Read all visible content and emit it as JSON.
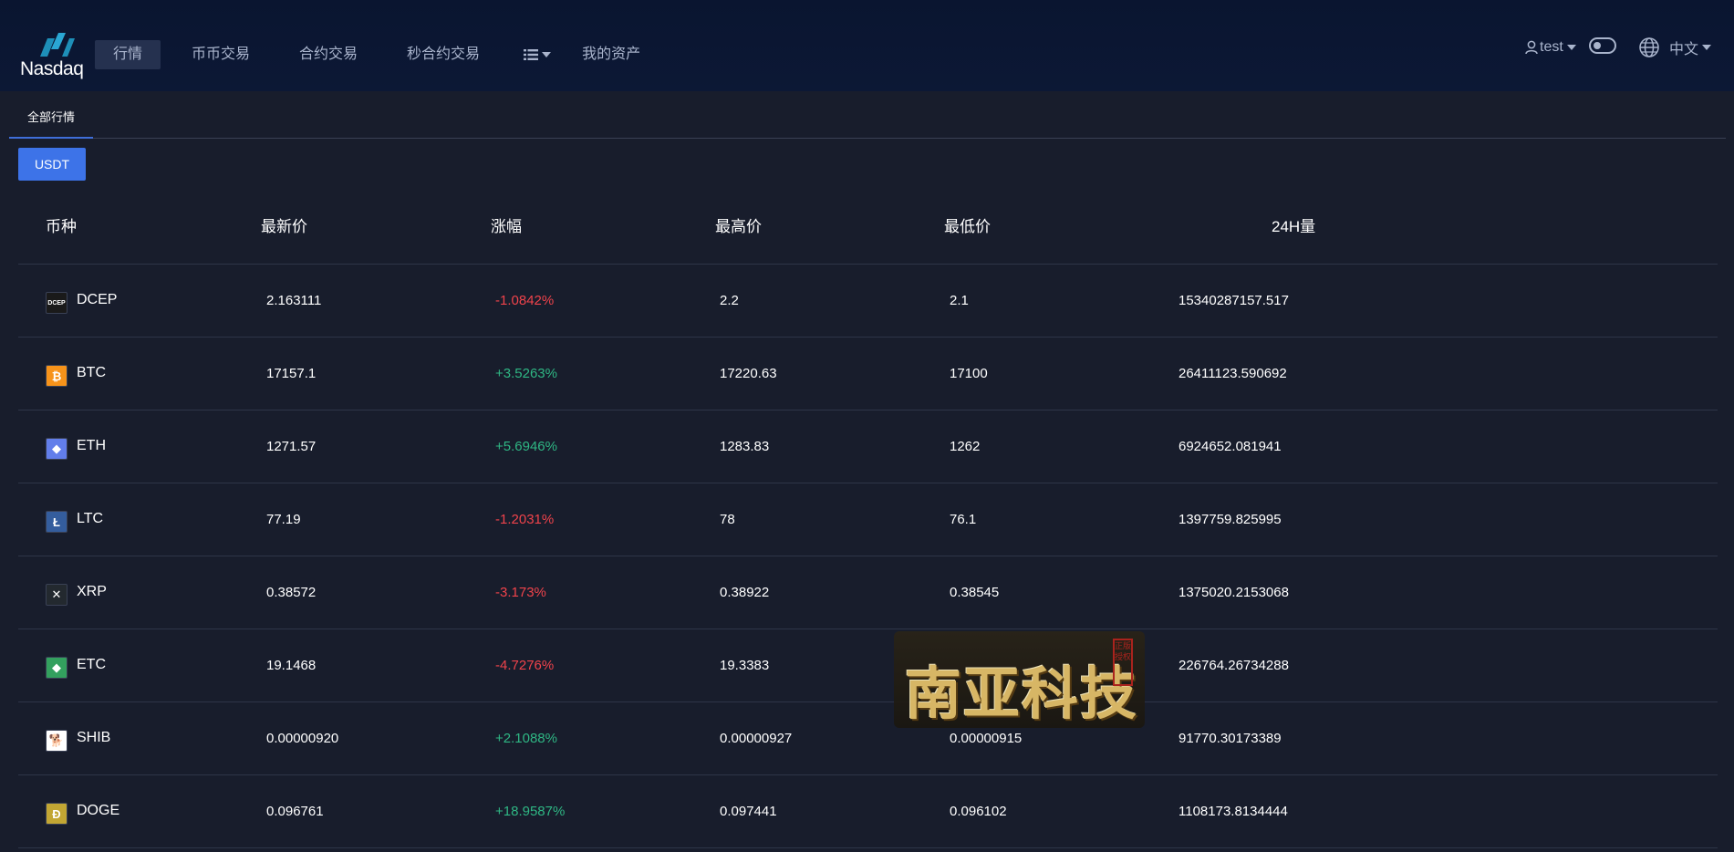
{
  "header": {
    "logo_text": "Nasdaq",
    "nav": [
      {
        "label": "行情",
        "active": true
      },
      {
        "label": "币币交易"
      },
      {
        "label": "合约交易"
      },
      {
        "label": "秒合约交易"
      }
    ],
    "assets_label": "我的资产",
    "user_label": "test",
    "lang_label": "中文"
  },
  "tabs": [
    {
      "label": "全部行情",
      "active": true
    }
  ],
  "quote_button": "USDT",
  "table": {
    "columns": [
      "币种",
      "最新价",
      "涨幅",
      "最高价",
      "最低价",
      "24H量"
    ],
    "rows": [
      {
        "coin": "DCEP",
        "icon": "dcep-icon",
        "icon_color": "#1a1a1a",
        "last": "2.163111",
        "change": "-1.0842%",
        "trend": "down",
        "high": "2.2",
        "low": "2.1",
        "volume": "15340287157.517"
      },
      {
        "coin": "BTC",
        "icon": "btc-icon",
        "icon_color": "#f7931a",
        "last": "17157.1",
        "change": "+3.5263%",
        "trend": "up",
        "high": "17220.63",
        "low": "17100",
        "volume": "26411123.590692"
      },
      {
        "coin": "ETH",
        "icon": "eth-icon",
        "icon_color": "#627eea",
        "last": "1271.57",
        "change": "+5.6946%",
        "trend": "up",
        "high": "1283.83",
        "low": "1262",
        "volume": "6924652.081941"
      },
      {
        "coin": "LTC",
        "icon": "ltc-icon",
        "icon_color": "#345d9d",
        "last": "77.19",
        "change": "-1.2031%",
        "trend": "down",
        "high": "78",
        "low": "76.1",
        "volume": "1397759.825995"
      },
      {
        "coin": "XRP",
        "icon": "xrp-icon",
        "icon_color": "#23292f",
        "last": "0.38572",
        "change": "-3.173%",
        "trend": "down",
        "high": "0.38922",
        "low": "0.38545",
        "volume": "1375020.2153068"
      },
      {
        "coin": "ETC",
        "icon": "etc-icon",
        "icon_color": "#33a05e",
        "last": "19.1468",
        "change": "-4.7276%",
        "trend": "down",
        "high": "19.3383",
        "low": "",
        "volume": "226764.26734288"
      },
      {
        "coin": "SHIB",
        "icon": "shib-icon",
        "icon_color": "#ffffff",
        "last": "0.00000920",
        "change": "+2.1088%",
        "trend": "up",
        "high": "0.00000927",
        "low": "0.00000915",
        "volume": "91770.30173389"
      },
      {
        "coin": "DOGE",
        "icon": "doge-icon",
        "icon_color": "#c2a633",
        "last": "0.096761",
        "change": "+18.9587%",
        "trend": "up",
        "high": "0.097441",
        "low": "0.096102",
        "volume": "1108173.8134444"
      }
    ]
  },
  "watermark": {
    "text": "南亚科技",
    "seal": "正版授权"
  },
  "colors": {
    "up": "#2fb784",
    "down": "#f0434b",
    "accent": "#3d73e8",
    "background": "#181d2c"
  }
}
